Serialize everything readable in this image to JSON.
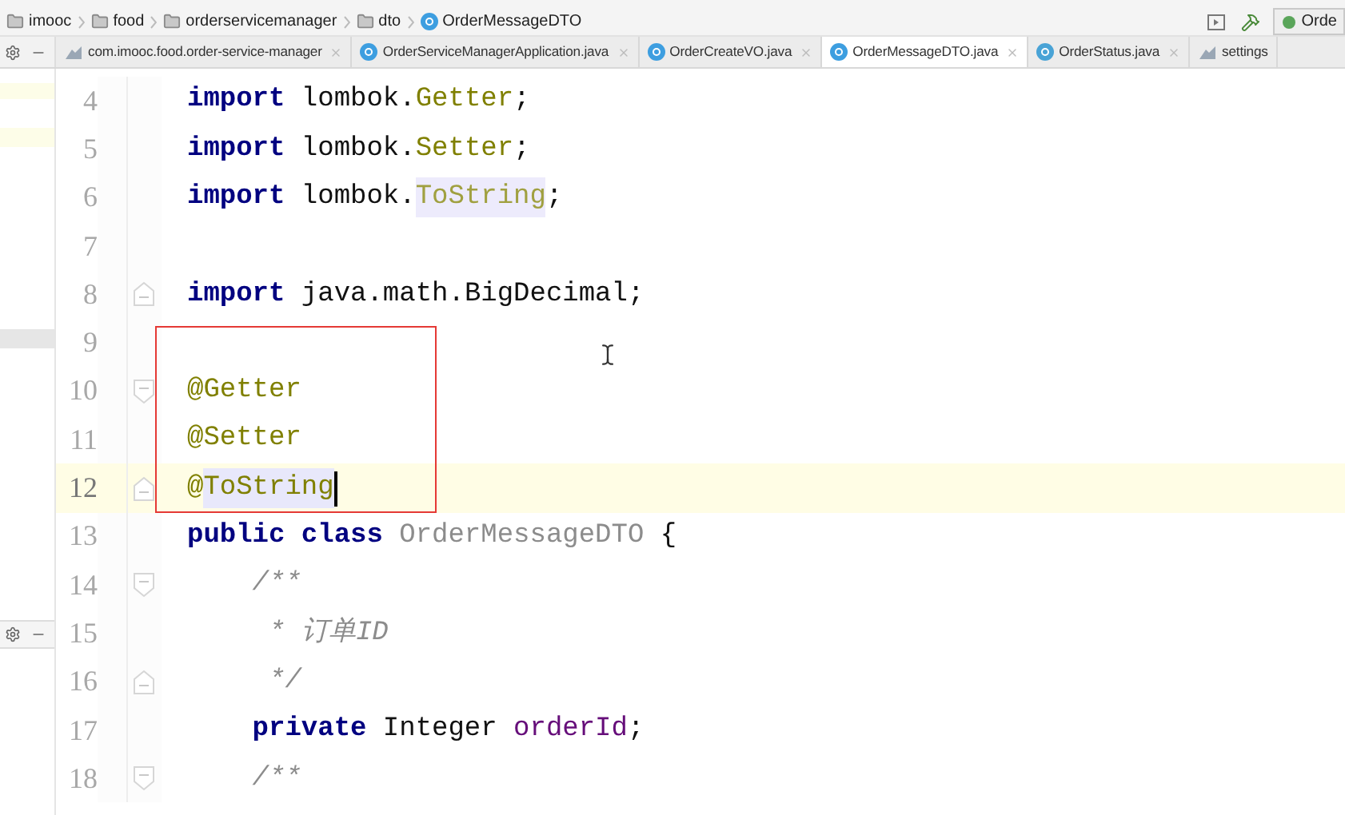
{
  "breadcrumb": [
    {
      "label": "imooc",
      "kind": "folder"
    },
    {
      "label": "food",
      "kind": "folder"
    },
    {
      "label": "orderservicemanager",
      "kind": "folder"
    },
    {
      "label": "dto",
      "kind": "folder"
    },
    {
      "label": "OrderMessageDTO",
      "kind": "class"
    }
  ],
  "run_config": {
    "label": "Orde"
  },
  "tabs": [
    {
      "label": "com.imooc.food.order-service-manager",
      "kind": "module",
      "selected": false,
      "closable": true
    },
    {
      "label": "OrderServiceManagerApplication.java",
      "kind": "class",
      "selected": false,
      "closable": true
    },
    {
      "label": "OrderCreateVO.java",
      "kind": "class",
      "selected": false,
      "closable": true
    },
    {
      "label": "OrderMessageDTO.java",
      "kind": "class",
      "selected": true,
      "closable": true
    },
    {
      "label": "OrderStatus.java",
      "kind": "enum",
      "selected": false,
      "closable": true
    },
    {
      "label": "settings",
      "kind": "module",
      "selected": false,
      "closable": false
    }
  ],
  "editor": {
    "lines": [
      {
        "number": "4",
        "current": false,
        "fold_start": false,
        "fold_end": false,
        "tokens": [
          {
            "kind": "keyword",
            "text": "import "
          },
          {
            "kind": "plain",
            "text": "lombok."
          },
          {
            "kind": "annotation",
            "text": "Getter"
          },
          {
            "kind": "plain",
            "text": ";"
          }
        ]
      },
      {
        "number": "5",
        "current": false,
        "fold_start": false,
        "fold_end": false,
        "tokens": [
          {
            "kind": "keyword",
            "text": "import "
          },
          {
            "kind": "plain",
            "text": "lombok."
          },
          {
            "kind": "annotation",
            "text": "Setter"
          },
          {
            "kind": "plain",
            "text": ";"
          }
        ]
      },
      {
        "number": "6",
        "current": false,
        "fold_start": false,
        "fold_end": false,
        "tokens": [
          {
            "kind": "keyword",
            "text": "import "
          },
          {
            "kind": "plain",
            "text": "lombok."
          },
          {
            "kind": "annotation_unused",
            "text": "ToString"
          },
          {
            "kind": "plain",
            "text": ";"
          }
        ]
      },
      {
        "number": "7",
        "current": false,
        "fold_start": false,
        "fold_end": false
      },
      {
        "number": "8",
        "current": false,
        "fold_start": false,
        "fold_end": true,
        "tokens": [
          {
            "kind": "keyword",
            "text": "import "
          },
          {
            "kind": "plain",
            "text": "java.math.BigDecimal;"
          }
        ]
      },
      {
        "number": "9",
        "current": false,
        "fold_start": false,
        "fold_end": false
      },
      {
        "number": "10",
        "current": false,
        "fold_start": true,
        "fold_end": false,
        "tokens": [
          {
            "kind": "annotation",
            "text": "@Getter"
          }
        ]
      },
      {
        "number": "11",
        "current": false,
        "fold_start": false,
        "fold_end": false,
        "tokens": [
          {
            "kind": "annotation",
            "text": "@Setter"
          }
        ]
      },
      {
        "number": "12",
        "current": true,
        "fold_start": false,
        "fold_end": true,
        "tokens": [
          {
            "kind": "annotation",
            "text": "@"
          },
          {
            "kind": "selection",
            "text": "ToString"
          }
        ]
      },
      {
        "number": "13",
        "current": false,
        "fold_start": false,
        "fold_end": false,
        "tokens": [
          {
            "kind": "keyword",
            "text": "public class "
          },
          {
            "kind": "unused",
            "text": "OrderMessageDTO"
          },
          {
            "kind": "plain",
            "text": " {"
          }
        ]
      },
      {
        "number": "14",
        "current": false,
        "fold_start": true,
        "fold_end": false,
        "tokens": [
          {
            "kind": "comment",
            "text": "    /**"
          }
        ]
      },
      {
        "number": "15",
        "current": false,
        "fold_start": false,
        "fold_end": false,
        "tokens": [
          {
            "kind": "comment",
            "text": "     * 订单ID"
          }
        ]
      },
      {
        "number": "16",
        "current": false,
        "fold_start": false,
        "fold_end": true,
        "tokens": [
          {
            "kind": "comment",
            "text": "     */"
          }
        ]
      },
      {
        "number": "17",
        "current": false,
        "fold_start": false,
        "fold_end": false,
        "tokens": [
          {
            "kind": "keyword",
            "text": "    private "
          },
          {
            "kind": "plain",
            "text": "Integer "
          },
          {
            "kind": "field",
            "text": "orderId"
          },
          {
            "kind": "plain",
            "text": ";"
          }
        ]
      },
      {
        "number": "18",
        "current": false,
        "fold_start": true,
        "fold_end": false,
        "tokens": [
          {
            "kind": "comment",
            "text": "    /**"
          }
        ]
      }
    ]
  }
}
